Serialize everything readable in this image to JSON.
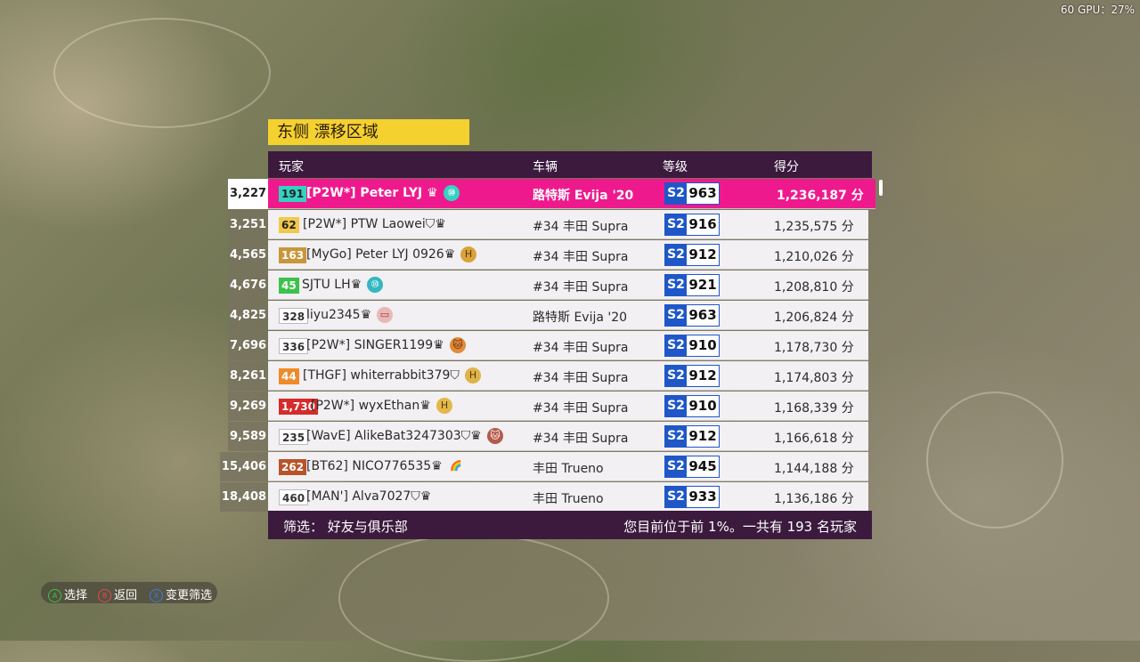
{
  "hud": {
    "fps": "60 GPU：27%"
  },
  "title": "东侧 漂移区域",
  "headers": {
    "player": "玩家",
    "car": "车辆",
    "class": "等级",
    "score": "得分"
  },
  "rows": [
    {
      "rank": "3,227",
      "level": "191",
      "name": "[P2W*] Peter LYJ ♛",
      "car": "路特斯 Evija '20",
      "class": "S2",
      "pi": "963",
      "score": "1,236,187 分",
      "badge": "⑩",
      "highlight": true
    },
    {
      "rank": "3,251",
      "level": "62",
      "name": "[P2W*] PTW Laowei⛉♛",
      "car": "#34 丰田 Supra",
      "class": "S2",
      "pi": "916",
      "score": "1,235,575 分",
      "badge": ""
    },
    {
      "rank": "4,565",
      "level": "163",
      "name": "[MyGo] Peter LYJ 0926♛",
      "car": "#34 丰田 Supra",
      "class": "S2",
      "pi": "912",
      "score": "1,210,026 分",
      "badge": "H"
    },
    {
      "rank": "4,676",
      "level": "45",
      "name": "SJTU LH♛",
      "car": "#34 丰田 Supra",
      "class": "S2",
      "pi": "921",
      "score": "1,208,810 分",
      "badge": "⑩"
    },
    {
      "rank": "4,825",
      "level": "328",
      "name": "liyu2345♛",
      "car": "路特斯 Evija '20",
      "class": "S2",
      "pi": "963",
      "score": "1,206,824 分",
      "badge": "▭"
    },
    {
      "rank": "7,696",
      "level": "336",
      "name": "[P2W*] SINGER1199♛",
      "car": "#34 丰田 Supra",
      "class": "S2",
      "pi": "910",
      "score": "1,178,730 分",
      "badge": "🐱"
    },
    {
      "rank": "8,261",
      "level": "44",
      "name": "[THGF] whiterrabbit379⛉",
      "car": "#34 丰田 Supra",
      "class": "S2",
      "pi": "912",
      "score": "1,174,803 分",
      "badge": "H"
    },
    {
      "rank": "9,269",
      "level": "1,730",
      "name": "[P2W*] wyxEthan♛",
      "car": "#34 丰田 Supra",
      "class": "S2",
      "pi": "910",
      "score": "1,168,339 分",
      "badge": "H"
    },
    {
      "rank": "9,589",
      "level": "235",
      "name": "[WavE] AlikeBat3247303⛉♛",
      "car": "#34 丰田 Supra",
      "class": "S2",
      "pi": "912",
      "score": "1,166,618 分",
      "badge": "🐱"
    },
    {
      "rank": "15,406",
      "level": "262",
      "name": "[BT62] NICO776535♛",
      "car": "丰田 Trueno",
      "class": "S2",
      "pi": "945",
      "score": "1,144,188 分",
      "badge": "🌈"
    },
    {
      "rank": "18,408",
      "level": "460",
      "name": "[MAN'] Alva7027⛉♛",
      "car": "丰田 Trueno",
      "class": "S2",
      "pi": "933",
      "score": "1,136,186 分",
      "badge": ""
    }
  ],
  "footer": {
    "filter_label": "筛选：  好友与俱乐部",
    "position_text": "您目前位于前 1%。一共有 193 名玩家"
  },
  "controls": [
    {
      "button": "A",
      "label": "选择",
      "color": "#3cc24a"
    },
    {
      "button": "B",
      "label": "返回",
      "color": "#e5484d"
    },
    {
      "button": "X",
      "label": "变更筛选",
      "color": "#3a7bea"
    }
  ],
  "colors": {
    "header": "#3b1a3e",
    "highlight": "#ee1a8d",
    "banner": "#f5d130",
    "class": "#1f57c8"
  }
}
